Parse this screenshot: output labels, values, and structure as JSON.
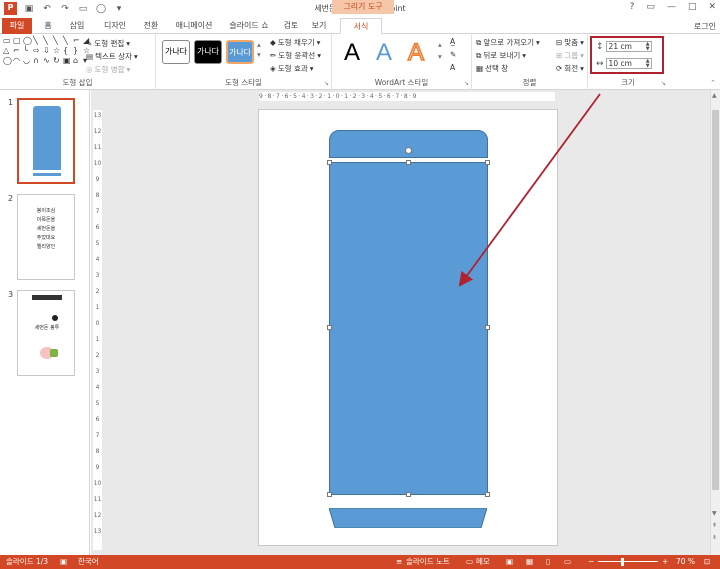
{
  "titlebar": {
    "title": "세번돈 봉투 - PowerPoint",
    "context_group": "그리기 도구",
    "window_buttons": [
      "?",
      "▭",
      "—",
      "□",
      "✕"
    ]
  },
  "tabs": [
    {
      "label": "파일"
    },
    {
      "label": "홈"
    },
    {
      "label": "삽입"
    },
    {
      "label": "디자인"
    },
    {
      "label": "전환"
    },
    {
      "label": "애니메이션"
    },
    {
      "label": "슬라이드 쇼"
    },
    {
      "label": "검토"
    },
    {
      "label": "보기"
    },
    {
      "label": "서식"
    }
  ],
  "login": "로그인",
  "ribbon": {
    "insert_shapes": {
      "label": "도형 삽입",
      "edit_shape": "도형 편집",
      "text_box": "텍스트 상자",
      "merge_shapes": "도형 병합"
    },
    "shape_styles": {
      "label": "도형 스타일",
      "sample": "가나다",
      "fill": "도형 채우기",
      "outline": "도형 윤곽선",
      "effects": "도형 효과"
    },
    "wordart": {
      "label": "WordArt 스타일",
      "letter": "A"
    },
    "arrange": {
      "label": "정렬",
      "bring_forward": "앞으로 가져오기",
      "send_backward": "뒤로 보내기",
      "selection_pane": "선택 창",
      "align": "맞춤",
      "group": "그룹",
      "rotate": "회전"
    },
    "size": {
      "label": "크기",
      "height": "21 cm",
      "width": "10 cm"
    }
  },
  "slides": [
    {
      "number": "1"
    },
    {
      "number": "2",
      "lines": [
        "봉이조심",
        "이목돈을",
        "세번돈을",
        "주었대요",
        "엘리양인"
      ]
    },
    {
      "number": "3",
      "text": "세번돈 봉투"
    }
  ],
  "ruler": {
    "h": "9·8·7·6·5·4·3·2·1·0·1·2·3·4·5·6·7·8·9",
    "v": [
      "13",
      "12",
      "11",
      "10",
      "9",
      "8",
      "7",
      "6",
      "5",
      "4",
      "3",
      "2",
      "1",
      "0",
      "1",
      "2",
      "3",
      "4",
      "5",
      "6",
      "7",
      "8",
      "9",
      "10",
      "11",
      "12",
      "13"
    ]
  },
  "status": {
    "slide_info": "슬라이드 1/3",
    "language": "한국어",
    "notes": "슬라이드 노트",
    "comments": "메모",
    "zoom": "70 %"
  },
  "colors": {
    "accent": "#d24726",
    "shape_fill": "#5b9bd5",
    "shape_border": "#41719c",
    "annotation": "#b1222f"
  }
}
